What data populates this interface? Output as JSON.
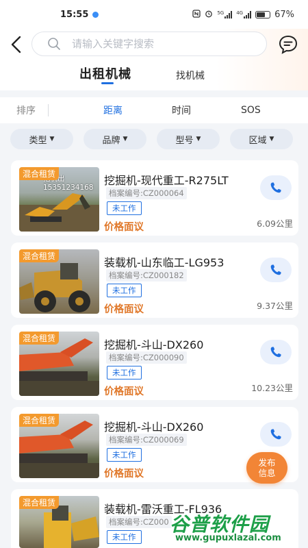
{
  "status_bar": {
    "time": "15:55",
    "battery_text": "67%",
    "battery_level": 0.67,
    "net_labels": [
      "5G",
      "4G"
    ]
  },
  "header": {
    "search_placeholder": "请输入关键字搜索",
    "tabs": [
      {
        "label": "出租机械",
        "active": true
      },
      {
        "label": "找机械",
        "active": false
      }
    ]
  },
  "sort_bar": {
    "label": "排序",
    "options": [
      {
        "label": "距离",
        "active": true
      },
      {
        "label": "时间",
        "active": false
      },
      {
        "label": "SOS",
        "active": false
      }
    ]
  },
  "filters": [
    {
      "label": "类型"
    },
    {
      "label": "品牌"
    },
    {
      "label": "型号"
    },
    {
      "label": "区域"
    }
  ],
  "listings": [
    {
      "tag": "混合租赁",
      "title": "挖掘机-现代重工-R275LT",
      "code": "档案编号:CZ000064",
      "status": "未工作",
      "price": "价格面议",
      "distance": "6.09公里",
      "photo_overlay": "挖机出\n15351234168"
    },
    {
      "tag": "混合租赁",
      "title": "装载机-山东临工-LG953",
      "code": "档案编号:CZ000182",
      "status": "未工作",
      "price": "价格面议",
      "distance": "9.37公里"
    },
    {
      "tag": "混合租赁",
      "title": "挖掘机-斗山-DX260",
      "code": "档案编号:CZ000090",
      "status": "未工作",
      "price": "价格面议",
      "distance": "10.23公里"
    },
    {
      "tag": "混合租赁",
      "title": "挖掘机-斗山-DX260",
      "code": "档案编号:CZ000069",
      "status": "未工作",
      "price": "价格面议",
      "distance": ""
    },
    {
      "tag": "混合租赁",
      "title": "装载机-雷沃重工-FL936",
      "code": "档案编号:CZ000",
      "status": "未工作",
      "price": "",
      "distance": ""
    }
  ],
  "publish_button": {
    "line1": "发布",
    "line2": "信息"
  },
  "watermark": {
    "text": "谷普软件园",
    "url": "www.gupuxlazal.com"
  },
  "colors": {
    "accent_blue": "#1f6fe0",
    "price_orange": "#e0782a",
    "tag_orange": "#f39a2e",
    "publish_orange": "#f28536",
    "watermark_green": "#1d9f48"
  }
}
